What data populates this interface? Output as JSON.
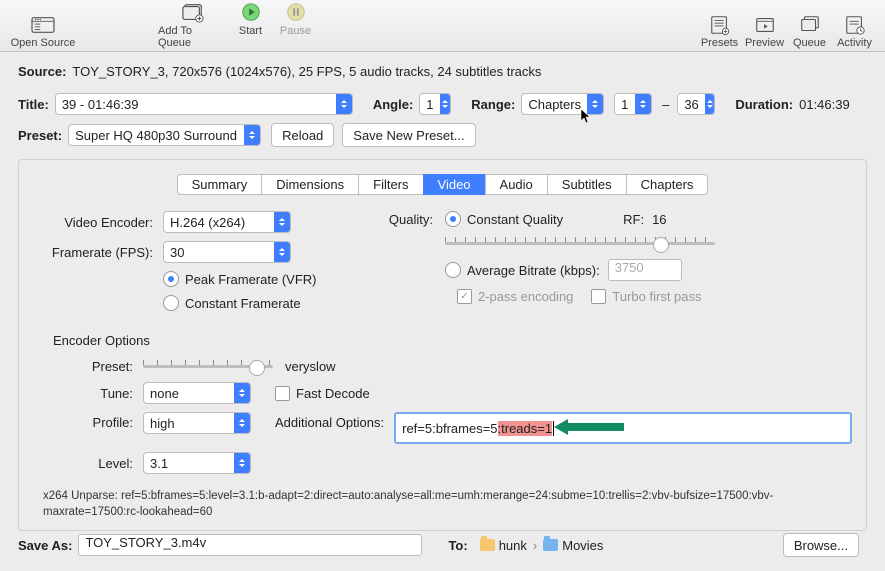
{
  "toolbar": {
    "open_source": "Open Source",
    "add_queue": "Add To Queue",
    "start": "Start",
    "pause": "Pause",
    "presets": "Presets",
    "preview": "Preview",
    "queue": "Queue",
    "activity": "Activity"
  },
  "source": {
    "label": "Source:",
    "value": "TOY_STORY_3, 720x576 (1024x576), 25 FPS, 5 audio tracks, 24 subtitles tracks"
  },
  "title": {
    "label": "Title:",
    "value": "39 - 01:46:39"
  },
  "angle": {
    "label": "Angle:",
    "value": "1"
  },
  "range": {
    "label": "Range:",
    "type": "Chapters",
    "from": "1",
    "sep": "–",
    "to": "36"
  },
  "duration": {
    "label": "Duration:",
    "value": "01:46:39"
  },
  "preset": {
    "label": "Preset:",
    "value": "Super HQ 480p30 Surround",
    "reload": "Reload",
    "save_new": "Save New Preset..."
  },
  "tabs": [
    "Summary",
    "Dimensions",
    "Filters",
    "Video",
    "Audio",
    "Subtitles",
    "Chapters"
  ],
  "active_tab": "Video",
  "video": {
    "encoder_label": "Video Encoder:",
    "encoder": "H.264 (x264)",
    "framerate_label": "Framerate (FPS):",
    "framerate": "30",
    "peak_fr": "Peak Framerate (VFR)",
    "const_fr": "Constant Framerate",
    "quality_label": "Quality:",
    "cq": "Constant Quality",
    "rf_label": "RF:",
    "rf_value": "16",
    "avg_bitrate": "Average Bitrate (kbps):",
    "bitrate_value": "3750",
    "two_pass": "2-pass encoding",
    "turbo": "Turbo first pass"
  },
  "encoder_options": {
    "title": "Encoder Options",
    "preset_label": "Preset:",
    "preset_value": "veryslow",
    "tune_label": "Tune:",
    "tune_value": "none",
    "fast_decode": "Fast Decode",
    "profile_label": "Profile:",
    "profile_value": "high",
    "level_label": "Level:",
    "level_value": "3.1",
    "addl_label": "Additional Options:",
    "addl_pre": "ref=5:bframes=5",
    "addl_hl": ":treads=1"
  },
  "unparse": "x264 Unparse: ref=5:bframes=5:level=3.1:b-adapt=2:direct=auto:analyse=all:me=umh:merange=24:subme=10:trellis=2:vbv-bufsize=17500:vbv-maxrate=17500:rc-lookahead=60",
  "save": {
    "label": "Save As:",
    "value": "TOY_STORY_3.m4v",
    "to_label": "To:",
    "path1": "hunk",
    "sep": "›",
    "path2": "Movies",
    "browse": "Browse..."
  }
}
